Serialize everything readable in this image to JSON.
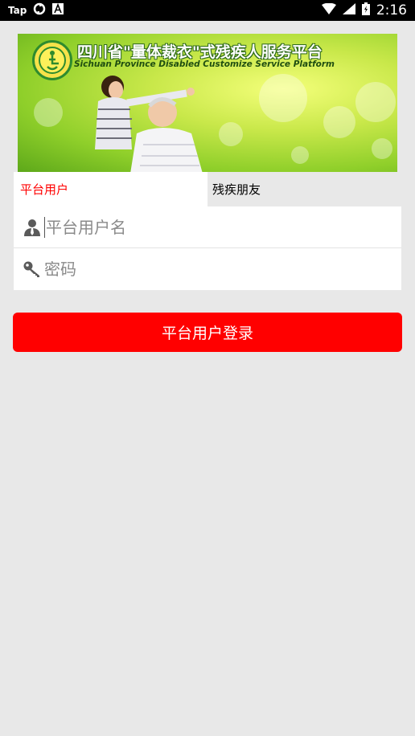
{
  "status_bar": {
    "app_label": "Tap",
    "time": "2:16",
    "icons": [
      "sync-icon",
      "font-icon",
      "wifi-icon",
      "signal-icon",
      "battery-icon"
    ]
  },
  "banner": {
    "title": "四川省\"量体裁衣\"式残疾人服务平台",
    "subtitle": "Sichuan Province Disabled Customize Service Platform"
  },
  "tabs": [
    {
      "label": "平台用户",
      "active": true
    },
    {
      "label": "残疾朋友",
      "active": false
    }
  ],
  "form": {
    "username": {
      "value": "",
      "placeholder": "平台用户名",
      "icon": "person-icon"
    },
    "password": {
      "value": "",
      "placeholder": "密码",
      "icon": "key-icon"
    }
  },
  "login_button": {
    "label": "平台用户登录"
  },
  "colors": {
    "accent": "#ff0000",
    "background": "#e8e8e8",
    "status_bar": "#000000"
  }
}
